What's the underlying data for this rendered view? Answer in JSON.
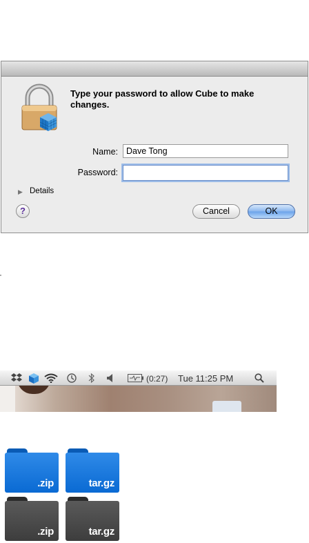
{
  "dialog": {
    "prompt": "Type your password to allow Cube to make changes.",
    "name_label": "Name:",
    "name_value": "Dave Tong",
    "password_label": "Password:",
    "password_value": "",
    "details_label": "Details",
    "help_label": "?",
    "cancel_label": "Cancel",
    "ok_label": "OK"
  },
  "menubar": {
    "icons": [
      "dropbox-icon",
      "cube-icon",
      "wifi-icon",
      "time-machine-icon",
      "bluetooth-icon",
      "volume-icon",
      "battery-icon",
      "spotlight-icon"
    ],
    "battery_text": "(0:27)",
    "clock": "Tue 11:25 PM"
  },
  "folders": [
    {
      "label": ".zip",
      "color": "#1a7be0"
    },
    {
      "label": "tar.gz",
      "color": "#1a7be0"
    },
    {
      "label": ".zip",
      "color": "#474747"
    },
    {
      "label": "tar.gz",
      "color": "#474747"
    }
  ]
}
